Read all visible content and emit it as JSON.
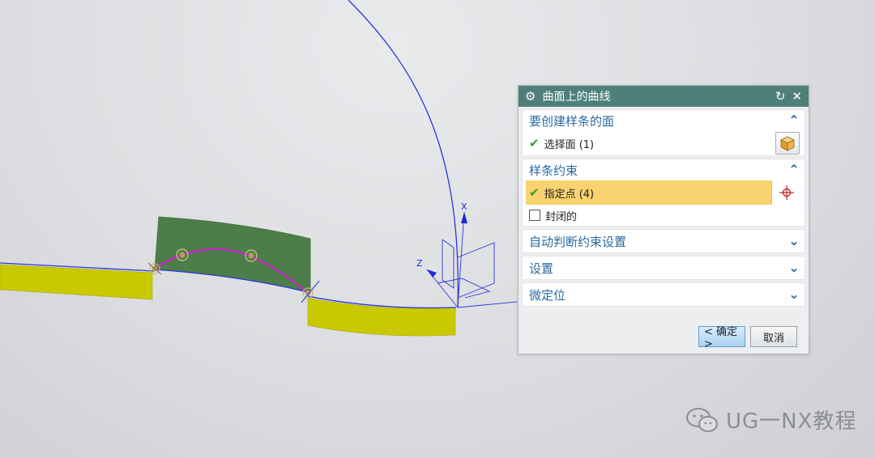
{
  "dialog": {
    "title": "曲面上的曲线",
    "sections": {
      "face": {
        "label": "要创建样条的面",
        "item": "选择面 (1)"
      },
      "constraint": {
        "label": "样条约束",
        "item": "指定点 (4)",
        "checkbox_label": "封闭的"
      },
      "auto": {
        "label": "自动判断约束设置"
      },
      "settings": {
        "label": "设置"
      },
      "locate": {
        "label": "微定位"
      }
    },
    "buttons": {
      "ok": "< 确定 >",
      "cancel": "取消"
    }
  },
  "axes": {
    "x": "X",
    "z": "Z"
  },
  "watermark": {
    "text": "UG一NX教程"
  },
  "colors": {
    "title_bar": "#4e8079",
    "highlight": "#f9d36f",
    "surface_yellow": "#cccc00",
    "surface_green": "#4d7e4a",
    "curve_blue": "#1b2bd6",
    "spline_magenta": "#d61ad6"
  }
}
